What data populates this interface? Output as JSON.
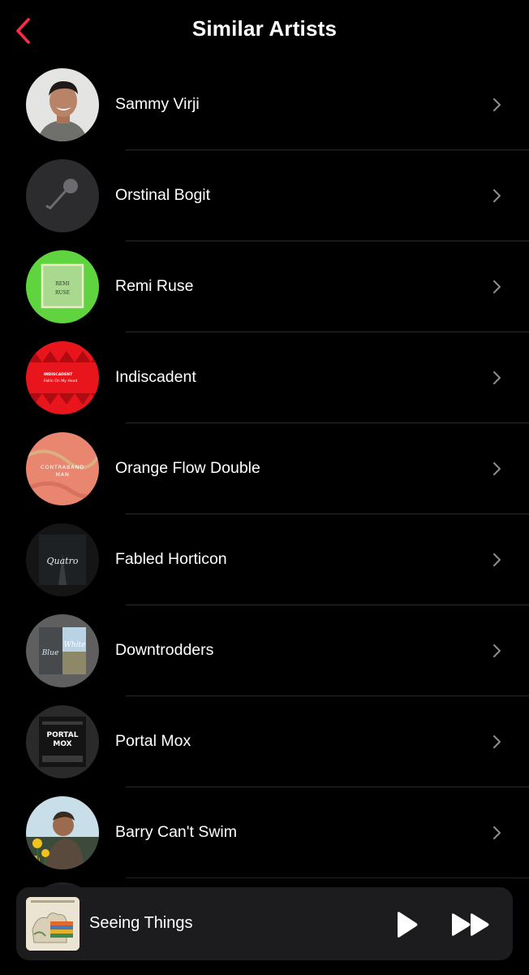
{
  "header": {
    "title": "Similar Artists",
    "accent": "#fa2d48"
  },
  "artists": [
    {
      "name": "Sammy Virji",
      "art": "portrait-photo"
    },
    {
      "name": "Orstinal Bogit",
      "art": "microphone-placeholder-icon"
    },
    {
      "name": "Remi Ruse",
      "art": "green-square-cover",
      "art_text": "REMI RUSE"
    },
    {
      "name": "Indiscadent",
      "art": "red-pattern-cover",
      "art_text": [
        "INDISCADENT",
        "Fallin On My Head"
      ]
    },
    {
      "name": "Orange Flow Double",
      "art": "salmon-marble-cover",
      "art_text": "CONTRABAND MAN"
    },
    {
      "name": "Fabled Horticon",
      "art": "dark-road-cover",
      "art_text": "Quatro"
    },
    {
      "name": "Downtrodders",
      "art": "split-blue-white-cover",
      "art_text": [
        "Blue",
        "White"
      ]
    },
    {
      "name": "Portal Mox",
      "art": "grunge-dark-cover",
      "art_text": [
        "PORTAL",
        "MOX"
      ]
    },
    {
      "name": "Barry Can't Swim",
      "art": "portrait-with-flowers"
    }
  ],
  "now_playing": {
    "title": "Seeing Things",
    "play_icon": "play-icon",
    "forward_icon": "fast-forward-icon"
  }
}
